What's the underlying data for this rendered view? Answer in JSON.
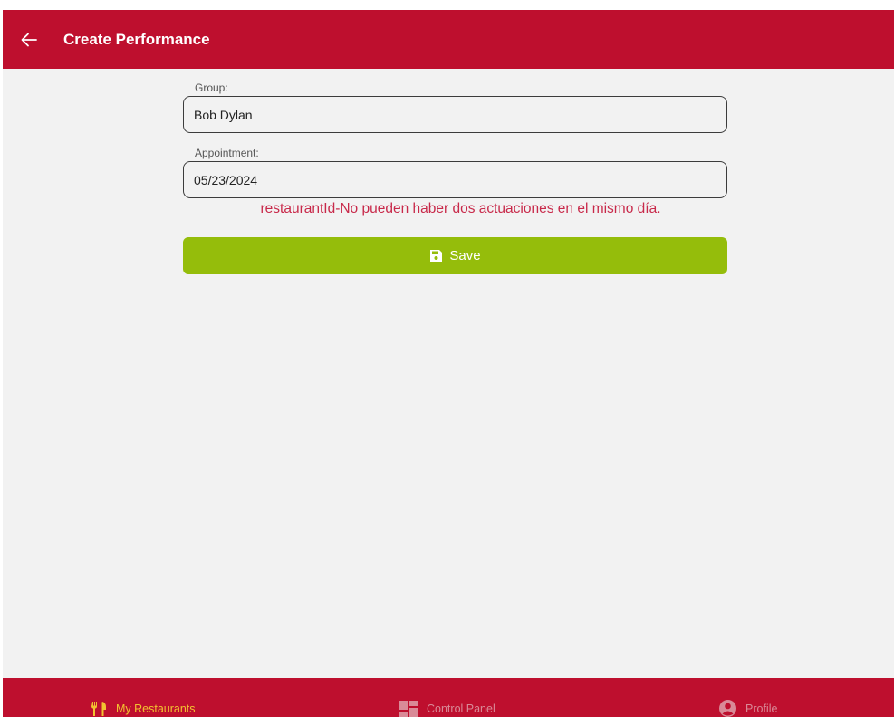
{
  "header": {
    "title": "Create Performance",
    "back_icon": "arrow-left-icon",
    "background": "#be0f2e"
  },
  "form": {
    "group": {
      "label": "Group:",
      "value": "Bob Dylan"
    },
    "appointment": {
      "label": "Appointment:",
      "value": "05/23/2024"
    },
    "error": "restaurantId-No pueden haber dos actuaciones en el mismo día.",
    "save": {
      "label": "Save",
      "icon": "floppy-disk-icon",
      "color": "#95bd0b"
    }
  },
  "tabbar": {
    "items": [
      {
        "label": "My Restaurants",
        "icon": "fork-knife-icon",
        "active": true
      },
      {
        "label": "Control Panel",
        "icon": "dashboard-icon",
        "active": false
      },
      {
        "label": "Profile",
        "icon": "user-circle-icon",
        "active": false
      }
    ],
    "active_color": "#f2c230",
    "inactive_color": "#d98a97"
  },
  "colors": {
    "primary": "#be0f2e",
    "error": "#c8294a",
    "background": "#f2f2f2"
  }
}
